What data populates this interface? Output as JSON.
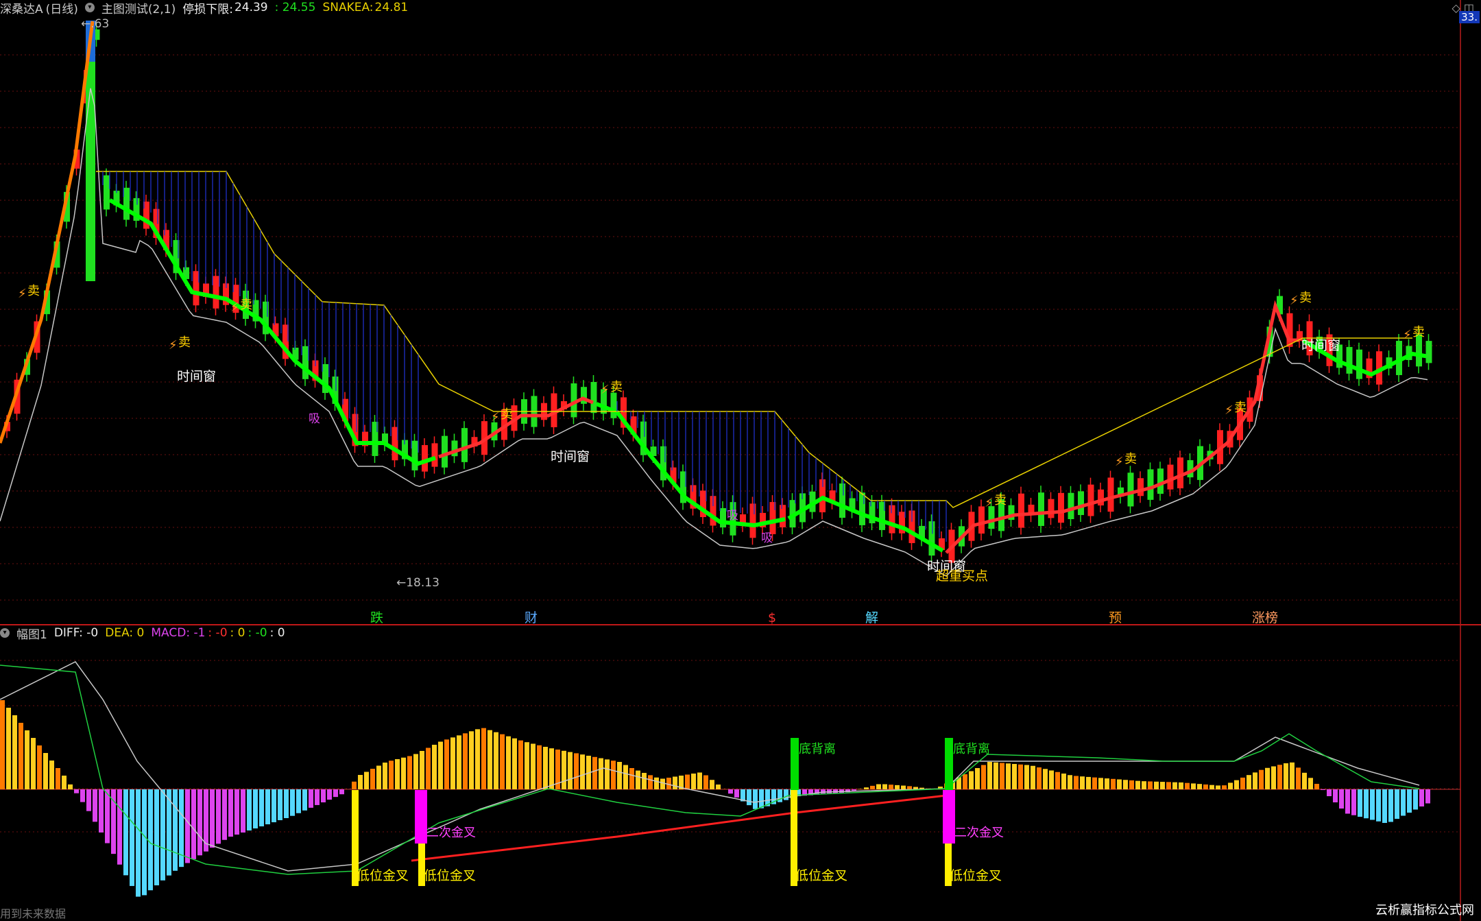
{
  "main_header": {
    "stock_name": "深桑达A",
    "period": "(日线)",
    "indicator_name": "主图测试(2,1)",
    "stop_loss_label": "停损下限:",
    "stop_loss_value": "24.39",
    "value2": ": 24.55",
    "snakea_label": "SNAKEA:",
    "snakea_value": "24.81"
  },
  "sub_header": {
    "pane_name": "幅图1",
    "diff": "DIFF: -0",
    "dea": "DEA: 0",
    "macd": "MACD: -1",
    "v1": ": -0",
    "v2": ": 0",
    "v3": ": -0",
    "v4": ": 0"
  },
  "price_badge": "33.",
  "max_label": "←",
  "max_value": ".63",
  "min_label": "←18.13",
  "watermark": "云析赢指标公式网",
  "future_note": "用到未来数据",
  "top_right_icons": "◇ ◫",
  "signals": {
    "sell": "卖",
    "window": "时间窗",
    "absorb": "吸",
    "buy_point": "超重买点",
    "low_cross": "低位金叉",
    "second_cross": "二次金叉",
    "bottom_div": "底背离"
  },
  "info_markers": [
    "跌",
    "财",
    "$",
    "解",
    "预",
    "涨榜"
  ],
  "colors": {
    "up": "#ff2020",
    "down": "#20e020",
    "snake_up": "#ff3030",
    "snake_down": "#00ff00",
    "yellow": "#e8d000",
    "white_line": "#c8c8c8",
    "cyan": "#55d8ff",
    "magenta": "#dd44ee",
    "divider": "#c01818"
  },
  "chart_data": {
    "type": "candlestick",
    "price_high": 33.63,
    "price_low": 18.13,
    "last_stop_loss": 24.39,
    "last_snakea": 24.81
  }
}
